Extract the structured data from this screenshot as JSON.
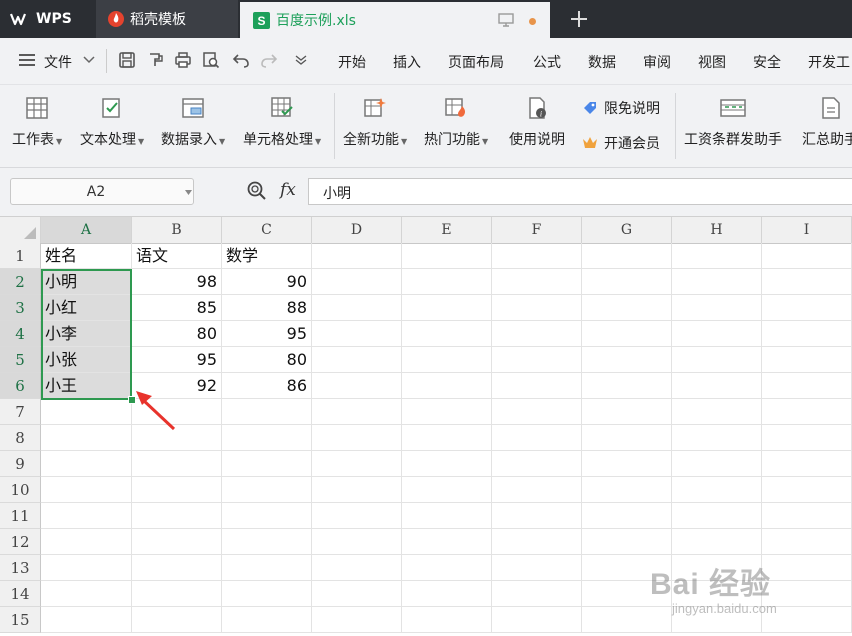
{
  "titlebar": {
    "tabs": [
      {
        "label": "WPS"
      },
      {
        "label": "稻壳模板"
      },
      {
        "label": "百度示例.xls"
      }
    ],
    "colors": {
      "bg": "#2b2e33",
      "accent_green": "#1da05a",
      "dot": "#e8944a"
    }
  },
  "menubar": {
    "file_label": "文件",
    "items": [
      "开始",
      "插入",
      "页面布局",
      "公式",
      "数据",
      "审阅",
      "视图",
      "安全",
      "开发工"
    ]
  },
  "ribbon": {
    "buttons": [
      {
        "label": "工作表",
        "icon": "worksheet-icon"
      },
      {
        "label": "文本处理",
        "icon": "text-process-icon"
      },
      {
        "label": "数据录入",
        "icon": "data-entry-icon"
      },
      {
        "label": "单元格处理",
        "icon": "cell-process-icon"
      },
      {
        "label": "全新功能",
        "icon": "new-feature-icon"
      },
      {
        "label": "热门功能",
        "icon": "hot-feature-icon"
      },
      {
        "label": "使用说明",
        "icon": "manual-icon"
      }
    ],
    "limited_free": "限免说明",
    "member": "开通会员",
    "salary_helper": "工资条群发助手",
    "summary_helper": "汇总助手"
  },
  "formula_bar": {
    "name_box": "A2",
    "fx": "fx",
    "value": "小明"
  },
  "sheet": {
    "columns": [
      "A",
      "B",
      "C",
      "D",
      "E",
      "F",
      "G",
      "H",
      "I"
    ],
    "rows": [
      "1",
      "2",
      "3",
      "4",
      "5",
      "6",
      "7",
      "8",
      "9",
      "10",
      "11",
      "12",
      "13",
      "14",
      "15"
    ],
    "data": [
      [
        "姓名",
        "语文",
        "数学"
      ],
      [
        "小明",
        "98",
        "90"
      ],
      [
        "小红",
        "85",
        "88"
      ],
      [
        "小李",
        "80",
        "95"
      ],
      [
        "小张",
        "95",
        "80"
      ],
      [
        "小王",
        "92",
        "86"
      ]
    ],
    "selection": "A2:A6"
  },
  "watermark": {
    "line1": "Bai 经验",
    "line2": "jingyan.baidu.com"
  }
}
